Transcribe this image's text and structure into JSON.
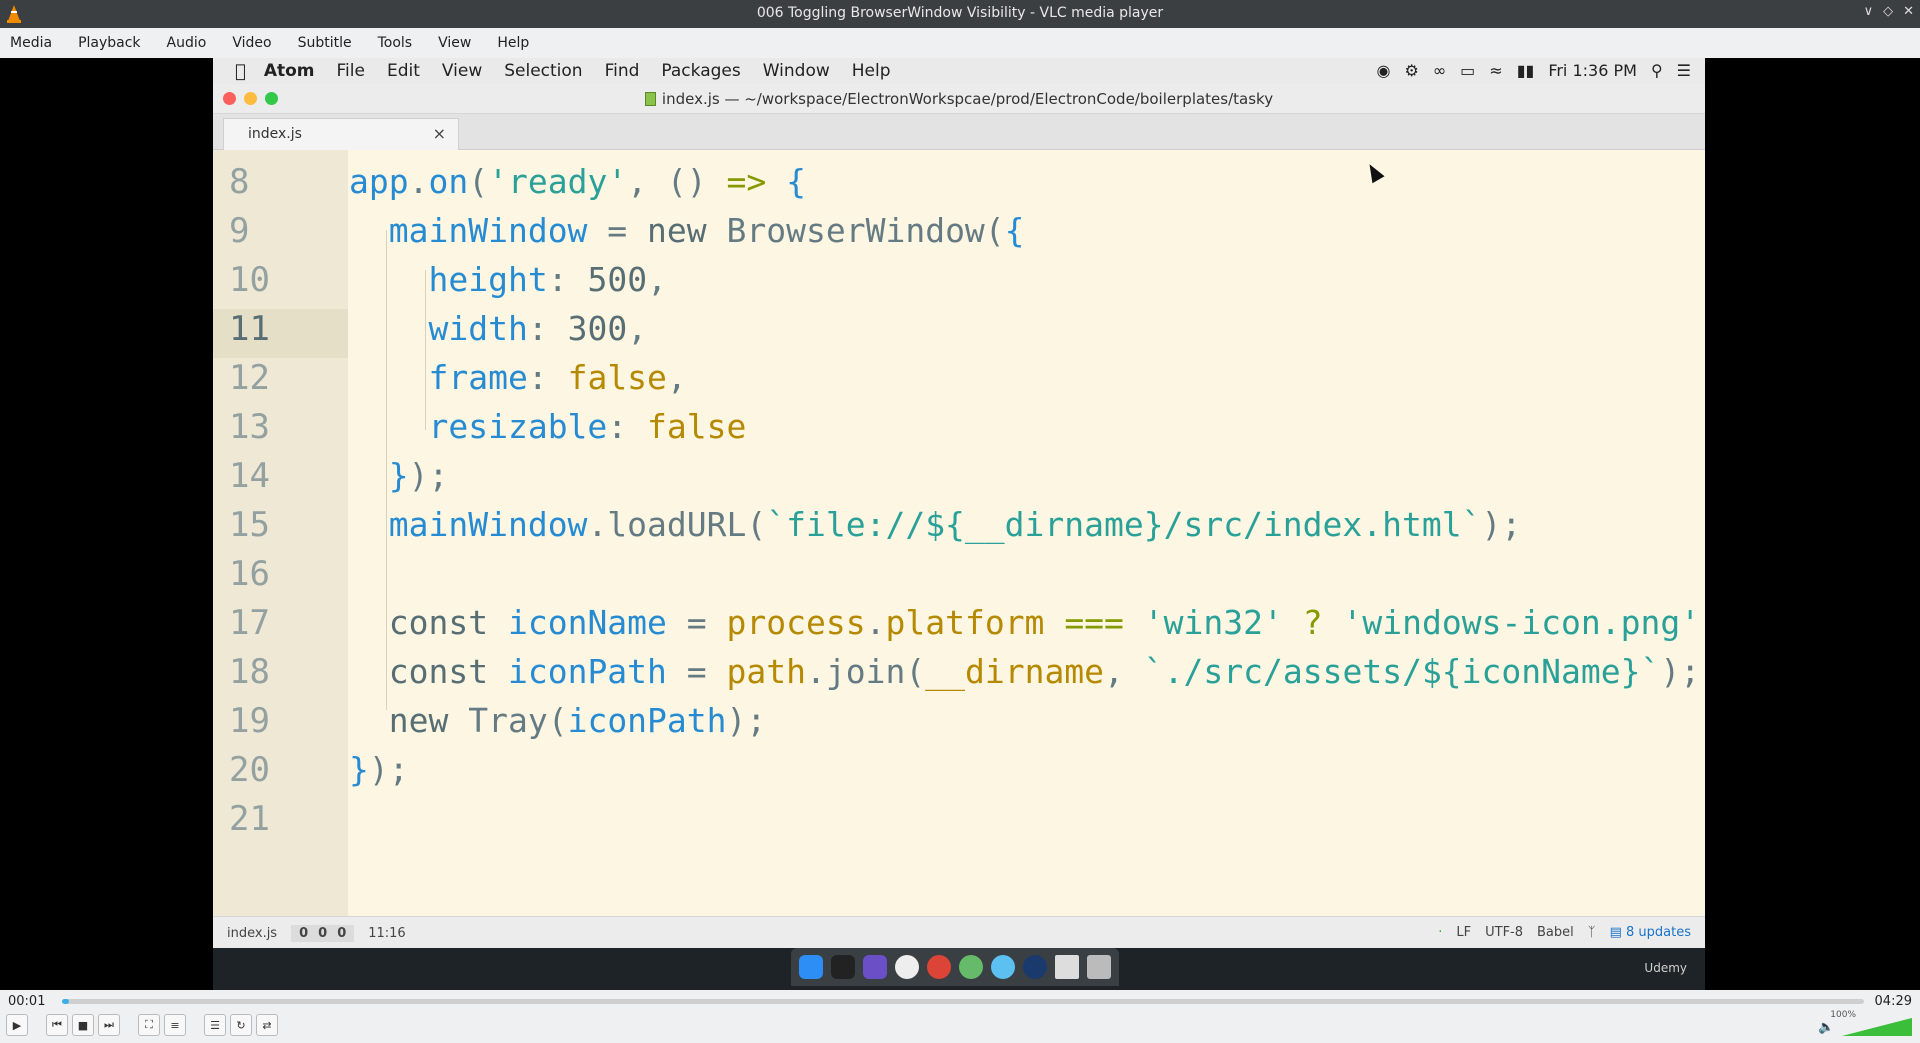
{
  "vlc": {
    "title": "006 Toggling BrowserWindow Visibility - VLC media player",
    "menu": [
      "Media",
      "Playback",
      "Audio",
      "Video",
      "Subtitle",
      "Tools",
      "View",
      "Help"
    ],
    "time_current": "00:01",
    "time_total": "04:29",
    "progress_fraction": 0.004,
    "volume_label": "100%"
  },
  "mac": {
    "app_name": "Atom",
    "menu": [
      "File",
      "Edit",
      "View",
      "Selection",
      "Find",
      "Packages",
      "Window",
      "Help"
    ],
    "clock": "Fri 1:36 PM"
  },
  "atom": {
    "window_title": "index.js — ~/workspace/ElectronWorkspcae/prod/ElectronCode/boilerplates/tasky",
    "tab_label": "index.js",
    "status": {
      "file": "index.js",
      "counts": [
        "0",
        "0",
        "0"
      ],
      "cursor": "11:16",
      "dot": "·",
      "line_ending": "LF",
      "encoding": "UTF-8",
      "grammar": "Babel",
      "updates": "8 updates"
    },
    "line_numbers": [
      "8",
      "9",
      "10",
      "11",
      "12",
      "13",
      "14",
      "15",
      "16",
      "17",
      "18",
      "19",
      "20",
      "21"
    ],
    "current_line": "11"
  },
  "watermark": "Udemy",
  "colors": {
    "editor_bg": "#fdf6e3",
    "gutter_bg": "#eee8d5",
    "string": "#2aa198",
    "identifier": "#268bd2",
    "keyword": "#859900"
  }
}
